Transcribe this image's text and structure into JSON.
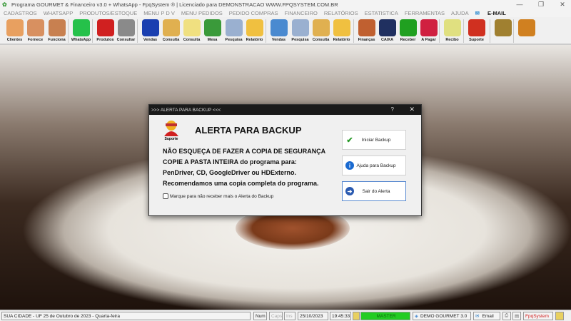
{
  "window": {
    "title": "Programa GOURMET & Financeiro v3.0 + WhatsApp - FpqSystem ® | Licenciado para  DEMONSTRACAO WWW.FPQSYSTEM.COM.BR",
    "minimize": "—",
    "maximize": "❐",
    "close": "✕"
  },
  "menu": [
    "CADASTROS",
    "WHATSAPP",
    "PRODUTOS/ESTOQUE",
    "MENU P D V",
    "MENU PEDIDOS",
    "PEDIDO COMPRAS",
    "FINANCEIRO",
    "RELATÓRIOS",
    "ESTATISTICA",
    "FERRAMENTAS",
    "AJUDA",
    "E-MAIL"
  ],
  "toolbar": [
    {
      "label": "Clientes",
      "color": "#e8a060"
    },
    {
      "label": "Fornece",
      "color": "#d89060"
    },
    {
      "label": "Funciona",
      "color": "#c88050"
    },
    {
      "label": "WhatsApp",
      "color": "#25c14a"
    },
    {
      "label": "Produtos",
      "color": "#d02020"
    },
    {
      "label": "Consultar",
      "color": "#8a8a8a"
    },
    {
      "label": "Vendas",
      "color": "#1a3fb0"
    },
    {
      "label": "Consulta",
      "color": "#e0b050"
    },
    {
      "label": "Consulta",
      "color": "#f0e080"
    },
    {
      "label": "Mesa",
      "color": "#3a9a3a"
    },
    {
      "label": "Pesquisa",
      "color": "#9ab0d0"
    },
    {
      "label": "Relatório",
      "color": "#f0c040"
    },
    {
      "label": "Vendas",
      "color": "#4a8ad0"
    },
    {
      "label": "Pesquisa",
      "color": "#9ab0d0"
    },
    {
      "label": "Consulta",
      "color": "#e0b050"
    },
    {
      "label": "Relatório",
      "color": "#f0c040"
    },
    {
      "label": "Finanças",
      "color": "#c06030"
    },
    {
      "label": "CAIXA",
      "color": "#203060"
    },
    {
      "label": "Receber",
      "color": "#20a020"
    },
    {
      "label": "A Pagar",
      "color": "#d02040"
    },
    {
      "label": "Recibo",
      "color": "#e0e080"
    },
    {
      "label": "Suporte",
      "color": "#d03020"
    },
    {
      "label": "",
      "color": "#a08030"
    },
    {
      "label": "",
      "color": "#d08020"
    }
  ],
  "dialog": {
    "title": ">>> ALERTA PARA BACKUP <<<",
    "help": "?",
    "close": "✕",
    "support_logo": "Suporte",
    "heading": "ALERTA PARA BACKUP",
    "lines": [
      "NÃO ESQUEÇA DE FAZER A COPIA DE SEGURANÇA",
      "COPIE A PASTA INTEIRA do programa para:",
      "PenDriver, CD, GoogleDriver ou HDExterno.",
      "Recomendamos uma copia completa do programa."
    ],
    "checkbox_label": "Marque para não receber mais o Alerta do Backup",
    "checkbox_checked": false,
    "buttons": [
      {
        "label": "Iniciar Backup",
        "icon": "✔"
      },
      {
        "label": "Ajuda para Backup",
        "icon": "i"
      },
      {
        "label": "Sair do Alerta",
        "icon": "➔"
      }
    ]
  },
  "status": {
    "city": "SUA CIDADE - UF 25 de Outubro de 2023 - Quarta-feira",
    "num": "Num",
    "caps": "Caps",
    "ins": "Ins",
    "date": "25/10/2023",
    "time": "19:45:33",
    "user": "MASTER",
    "company": "DEMO GOURMET 3.0",
    "email": "Email",
    "brand": "FpqSystem"
  }
}
